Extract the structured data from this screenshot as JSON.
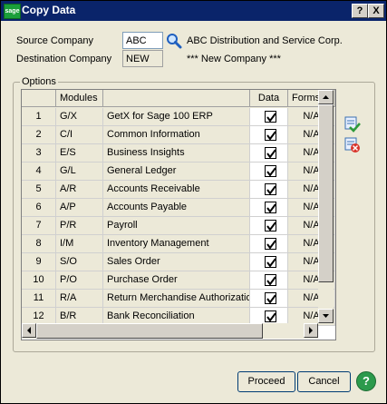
{
  "window": {
    "title": "Copy Data",
    "logo_text": "sage",
    "help_glyph": "?",
    "close_glyph": "X"
  },
  "form": {
    "source_label": "Source Company",
    "source_value": "ABC",
    "source_name": "ABC Distribution and Service Corp.",
    "destination_label": "Destination Company",
    "destination_value": "NEW",
    "destination_name": "*** New Company ***"
  },
  "options": {
    "legend": "Options",
    "headers": {
      "num": "",
      "modules": "Modules",
      "name": "",
      "data": "Data",
      "forms": "Forms"
    },
    "rows": [
      {
        "num": "1",
        "code": "G/X",
        "name": "GetX for Sage 100 ERP",
        "data": true,
        "forms": "N/A"
      },
      {
        "num": "2",
        "code": "C/I",
        "name": "Common Information",
        "data": true,
        "forms": "N/A"
      },
      {
        "num": "3",
        "code": "E/S",
        "name": "Business Insights",
        "data": true,
        "forms": "N/A"
      },
      {
        "num": "4",
        "code": "G/L",
        "name": "General Ledger",
        "data": true,
        "forms": "N/A"
      },
      {
        "num": "5",
        "code": "A/R",
        "name": "Accounts Receivable",
        "data": true,
        "forms": "N/A"
      },
      {
        "num": "6",
        "code": "A/P",
        "name": "Accounts Payable",
        "data": true,
        "forms": "N/A"
      },
      {
        "num": "7",
        "code": "P/R",
        "name": "Payroll",
        "data": true,
        "forms": "N/A"
      },
      {
        "num": "8",
        "code": "I/M",
        "name": "Inventory Management",
        "data": true,
        "forms": "N/A"
      },
      {
        "num": "9",
        "code": "S/O",
        "name": "Sales Order",
        "data": true,
        "forms": "N/A"
      },
      {
        "num": "10",
        "code": "P/O",
        "name": "Purchase Order",
        "data": true,
        "forms": "N/A"
      },
      {
        "num": "11",
        "code": "R/A",
        "name": "Return Merchandise Authorization",
        "data": true,
        "forms": "N/A"
      },
      {
        "num": "12",
        "code": "B/R",
        "name": "Bank Reconciliation",
        "data": true,
        "forms": "N/A"
      }
    ]
  },
  "buttons": {
    "proceed": "Proceed",
    "cancel": "Cancel",
    "help": "?"
  },
  "icons": {
    "lookup": "magnifier-icon",
    "select_all": "check-all-icon",
    "clear_all": "clear-all-icon"
  }
}
